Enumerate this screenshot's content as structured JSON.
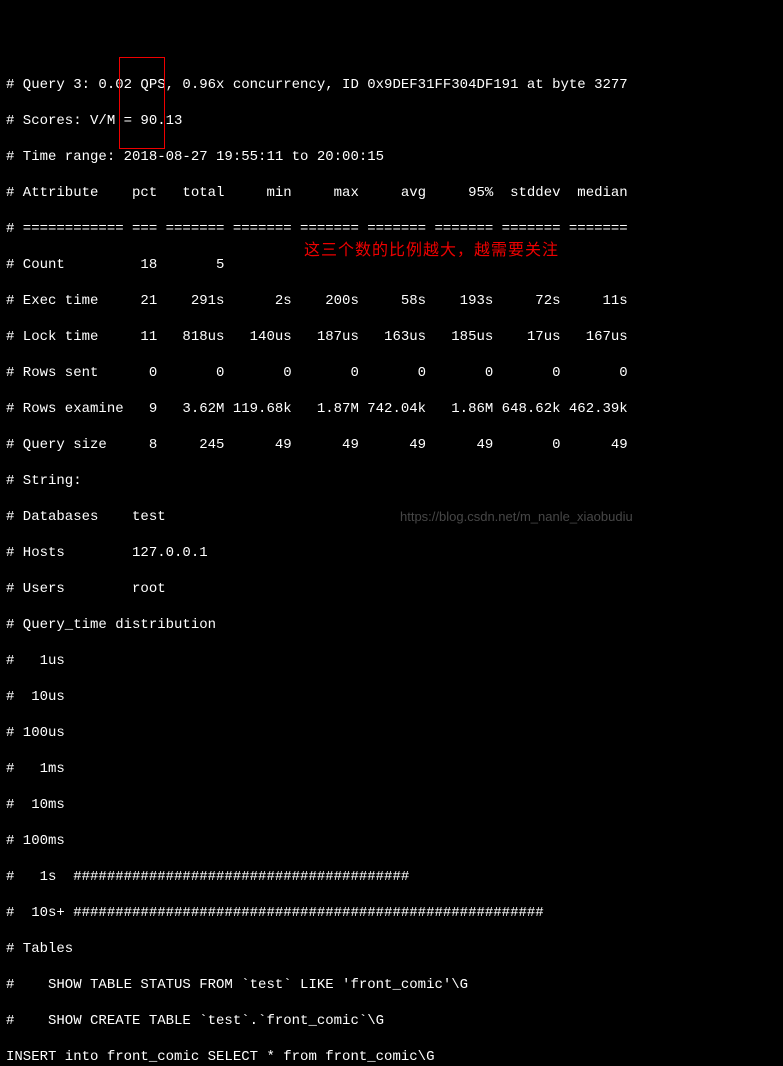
{
  "header": {
    "line1": "# Query 3: 0.02 QPS, 0.96x concurrency, ID 0x9DEF31FF304DF191 at byte 3277",
    "line2": "# Scores: V/M = 90.13",
    "line3": "# Time range: 2018-08-27 19:55:11 to 20:00:15"
  },
  "table_header": "# Attribute    pct   total     min     max     avg     95%  stddev  median",
  "table_divider": "# ============ === ======= ======= ======= ======= ======= ======= =======",
  "rows": {
    "count": "# Count         18       5",
    "exec_time": "# Exec time     21    291s      2s    200s     58s    193s     72s     11s",
    "lock_time": "# Lock time     11   818us   140us   187us   163us   185us    17us   167us",
    "rows_sent": "# Rows sent      0       0       0       0       0       0       0       0",
    "rows_examine": "# Rows examine   9   3.62M 119.68k   1.87M 742.04k   1.86M 648.62k 462.39k",
    "query_size": "# Query size     8     245      49      49      49      49       0      49"
  },
  "info": {
    "string": "# String:",
    "databases": "# Databases    test",
    "hosts": "# Hosts        127.0.0.1",
    "users": "# Users        root"
  },
  "dist_header": "# Query_time distribution",
  "dist": {
    "us1": "#   1us",
    "us10": "#  10us",
    "us100": "# 100us",
    "ms1": "#   1ms",
    "ms10": "#  10ms",
    "ms100": "# 100ms",
    "s1": "#   1s  ########################################",
    "s10p": "#  10s+ ########################################################",
    "tables": "# Tables",
    "show1": "#    SHOW TABLE STATUS FROM `test` LIKE 'front_comic'\\G",
    "show2": "#    SHOW CREATE TABLE `test`.`front_comic`\\G",
    "insert": "INSERT into front_comic SELECT * from front_comic\\G"
  },
  "annotation_cn": "这三个数的比例越大，越需要关注",
  "watermark": "https://blog.csdn.net/m_nanle_xiaobudiu",
  "chart_data": {
    "type": "table",
    "title": "Query 3 profile",
    "qps": 0.02,
    "concurrency": 0.96,
    "id": "0x9DEF31FF304DF191",
    "byte": 3277,
    "scores_vm": 90.13,
    "time_range": {
      "from": "2018-08-27 19:55:11",
      "to": "20:00:15"
    },
    "columns": [
      "Attribute",
      "pct",
      "total",
      "min",
      "max",
      "avg",
      "95%",
      "stddev",
      "median"
    ],
    "rows": [
      {
        "Attribute": "Count",
        "pct": 18,
        "total": 5
      },
      {
        "Attribute": "Exec time",
        "pct": 21,
        "total": "291s",
        "min": "2s",
        "max": "200s",
        "avg": "58s",
        "95%": "193s",
        "stddev": "72s",
        "median": "11s"
      },
      {
        "Attribute": "Lock time",
        "pct": 11,
        "total": "818us",
        "min": "140us",
        "max": "187us",
        "avg": "163us",
        "95%": "185us",
        "stddev": "17us",
        "median": "167us"
      },
      {
        "Attribute": "Rows sent",
        "pct": 0,
        "total": 0,
        "min": 0,
        "max": 0,
        "avg": 0,
        "95%": 0,
        "stddev": 0,
        "median": 0
      },
      {
        "Attribute": "Rows examine",
        "pct": 9,
        "total": "3.62M",
        "min": "119.68k",
        "max": "1.87M",
        "avg": "742.04k",
        "95%": "1.86M",
        "stddev": "648.62k",
        "median": "462.39k"
      },
      {
        "Attribute": "Query size",
        "pct": 8,
        "total": 245,
        "min": 49,
        "max": 49,
        "avg": 49,
        "95%": 49,
        "stddev": 0,
        "median": 49
      }
    ],
    "databases": "test",
    "hosts": "127.0.0.1",
    "users": "root",
    "query_time_distribution": {
      "1us": 0,
      "10us": 0,
      "100us": 0,
      "1ms": 0,
      "10ms": 0,
      "100ms": 0,
      "1s": 40,
      "10s+": 56
    },
    "tables": [
      "front_comic"
    ],
    "statements": [
      "SHOW TABLE STATUS FROM `test` LIKE 'front_comic'\\G",
      "SHOW CREATE TABLE `test`.`front_comic`\\G",
      "INSERT into front_comic SELECT * from front_comic\\G"
    ]
  }
}
